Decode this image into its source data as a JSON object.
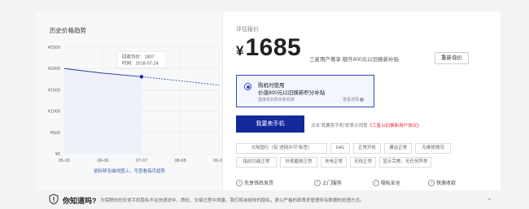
{
  "history": {
    "title": "历史价格趋势",
    "hint": "鼠标移至曲线图上，可查看每月趋势",
    "tooltip": {
      "avg": "回收均价：1807",
      "time": "时间：2018-07-24"
    }
  },
  "chart_data": {
    "type": "line",
    "categories": [
      "05-05",
      "06-06",
      "07-07",
      "08-08",
      "09-09"
    ],
    "y_ticks": [
      "¥2500",
      "¥2000",
      "¥1500",
      "¥1000",
      "¥500",
      "¥0"
    ],
    "ylim": [
      0,
      2500
    ],
    "series": [
      {
        "values": [
          2000,
          1890,
          1807,
          1710,
          1610
        ]
      }
    ],
    "highlight_point": {
      "x": "07-07",
      "y": 1807
    },
    "grid": true
  },
  "evaluation": {
    "label": "评估报价",
    "currency": "¥",
    "price": "1685",
    "note": "三星用户尊享 额外800元以旧换新补贴",
    "reevaluate": "重新询价"
  },
  "option": {
    "title": "购机时使用",
    "subtitle": "价值800元以旧换新积分补贴",
    "note": "直接抵扣购买新机款",
    "link": "查看详情"
  },
  "sell": {
    "button": "我要卖手机",
    "agree_prefix": "点击“我要卖手机”即表示同意",
    "agree_link": "《三星以旧换新用户协议》"
  },
  "tags": [
    "大陆国行（有“进网许可”标签）",
    "64G",
    "正常开机",
    "通话正常",
    "无维修情况",
    "指纹功能正常",
    "外观磨损正常",
    "充电正常",
    "无线正常",
    "显示完美，无任何异常"
  ],
  "services": [
    "先享钱后发货",
    "上门服务",
    "隐私安全",
    "快速收款"
  ],
  "bottom": {
    "title": "你知道吗?",
    "text": "为保障你的安卓手机隐私不在快递途中、质检、交易过程中泄露，我们将抹掉你的隐私，更以严格的政策来管理所有数据的处理方式。"
  },
  "colors": {
    "accent": "#13289a",
    "link": "#3d5fb0",
    "red": "#e23"
  }
}
